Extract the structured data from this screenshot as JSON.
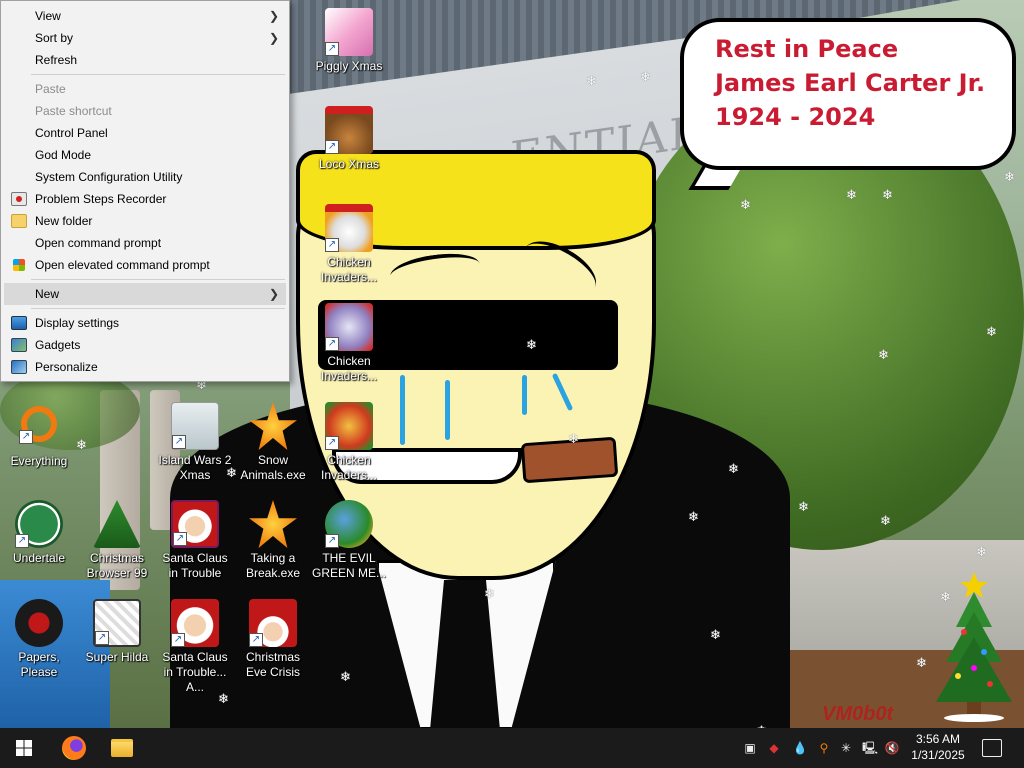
{
  "wallpaper": {
    "bubble_lines": [
      "Rest in Peace",
      "James Earl Carter Jr.",
      "1924 - 2024"
    ],
    "watermark": "VM0b0t",
    "building_letters": "ENTIAL"
  },
  "context_menu": {
    "items": [
      {
        "label": "View",
        "submenu": true
      },
      {
        "label": "Sort by",
        "submenu": true
      },
      {
        "label": "Refresh"
      },
      {
        "label": "Paste",
        "disabled": true
      },
      {
        "label": "Paste shortcut",
        "disabled": true
      },
      {
        "label": "Control Panel"
      },
      {
        "label": "God Mode"
      },
      {
        "label": "System Configuration Utility"
      },
      {
        "label": "Problem Steps Recorder",
        "icon": "steps-recorder-icon"
      },
      {
        "label": "New folder",
        "icon": "folder-icon"
      },
      {
        "label": "Open command prompt"
      },
      {
        "label": "Open elevated command prompt",
        "icon": "windows-shield-icon"
      },
      {
        "label": "New",
        "submenu": true,
        "highlighted": true
      },
      {
        "label": "Display settings",
        "icon": "display-icon"
      },
      {
        "label": "Gadgets",
        "icon": "gadgets-icon"
      },
      {
        "label": "Personalize",
        "icon": "personalize-icon"
      }
    ]
  },
  "desktop_icons": [
    {
      "label": "Piggly Xmas",
      "icon": "piggly-xmas-icon"
    },
    {
      "label": "Loco Xmas",
      "icon": "loco-xmas-icon"
    },
    {
      "label": "Chicken Invaders...",
      "icon": "chicken-invaders-icon"
    },
    {
      "label": "Chicken Invaders...",
      "icon": "chicken-invaders-icon"
    },
    {
      "label": "Chicken Invaders...",
      "icon": "chicken-invaders-icon"
    },
    {
      "label": "THE EVIL GREEN ME...",
      "icon": "evil-green-icon"
    },
    {
      "label": "Everything",
      "icon": "everything-search-icon"
    },
    {
      "label": "Island Wars 2 Xmas",
      "icon": "island-wars-icon"
    },
    {
      "label": "Snow Animals.exe",
      "icon": "snow-animals-icon"
    },
    {
      "label": "Undertale",
      "icon": "undertale-icon"
    },
    {
      "label": "Christmas Browser 99",
      "icon": "christmas-browser-icon"
    },
    {
      "label": "Santa Claus in Trouble",
      "icon": "santa-icon"
    },
    {
      "label": "Taking a Break.exe",
      "icon": "taking-break-icon"
    },
    {
      "label": "Papers, Please",
      "icon": "papers-please-icon"
    },
    {
      "label": "Super Hilda",
      "icon": "super-hilda-icon"
    },
    {
      "label": "Santa Claus in Trouble... A...",
      "icon": "santa-icon"
    },
    {
      "label": "Christmas Eve Crisis",
      "icon": "christmas-eve-crisis-icon"
    }
  ],
  "taskbar": {
    "pinned": [
      {
        "name": "start",
        "icon": "windows-logo-icon"
      },
      {
        "name": "firefox",
        "icon": "firefox-icon"
      },
      {
        "name": "file-explorer",
        "icon": "folder-icon"
      }
    ],
    "tray": {
      "time": "3:56 AM",
      "date": "1/31/2025"
    }
  },
  "colors": {
    "bubble_text": "#c91c33",
    "taskbar": "#1b1b1b",
    "menu_bg": "#f2f2f2",
    "menu_hover": "#d9d9d9"
  }
}
